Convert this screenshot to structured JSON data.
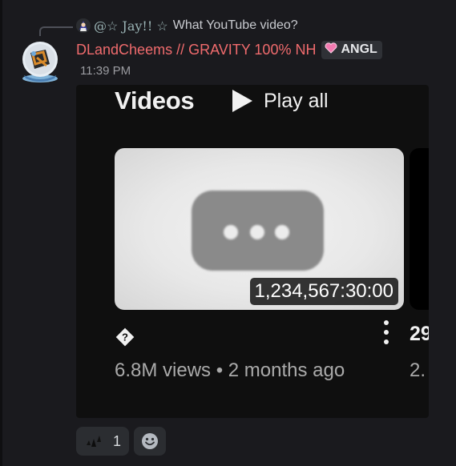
{
  "reply": {
    "author": "@☆ Jay!! ☆",
    "text": "What YouTube video?"
  },
  "message": {
    "username": "DLandCheems // GRAVITY 100% NH",
    "tag": "ANGL",
    "timestamp": "11:39 PM"
  },
  "embed": {
    "section_title": "Videos",
    "play_all_label": "Play all",
    "duration": "1,234,567:30:00",
    "meta": "6.8M views • 2 months ago",
    "next_title_partial": "29",
    "next_meta_partial": "2.",
    "colors": {
      "background": "#0f0f0f",
      "text": "#f1f1f1",
      "secondary_text": "#aaaaaa"
    }
  },
  "reactions": [
    {
      "emoji": "small-character-emoji",
      "count": "1"
    }
  ],
  "icons": {
    "play": "play-icon",
    "question": "question-icon",
    "more": "kebab-menu-icon",
    "add_reaction": "smiley-icon"
  }
}
